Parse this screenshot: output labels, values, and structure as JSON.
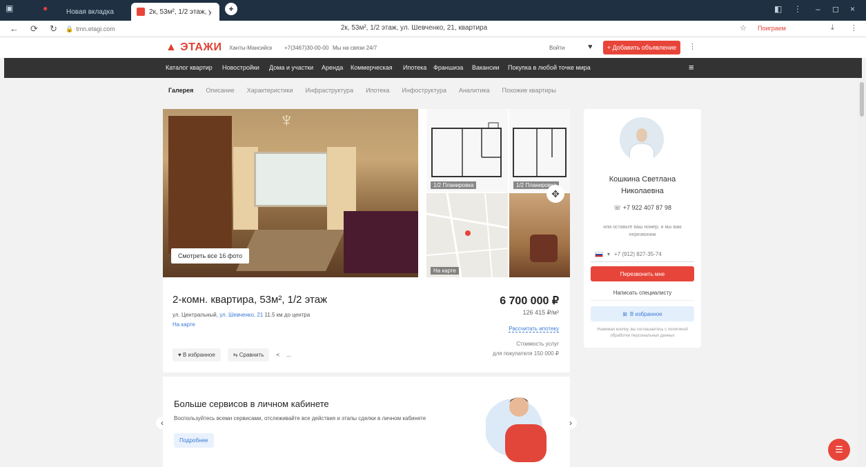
{
  "browser": {
    "tabs": [
      {
        "label": "Новая вкладка",
        "active": false
      },
      {
        "label": "2к, 53м², 1/2 этаж, ул...",
        "active": true
      }
    ],
    "window_title": "2к, 53м², 1/2 этаж, ул. Шевченко, 21, квартира",
    "url": "tmn.etagi.com",
    "profile_label": "Поиграем",
    "new_tab": "+"
  },
  "header": {
    "logo": "ЭТАЖИ",
    "city": "Ханты-Мансийск",
    "phone": "+7(3467)30-00-00",
    "hours": "Мы на связи 24/7",
    "login": "Войти",
    "cta": "+ Добавить объявление"
  },
  "nav": {
    "items": [
      "Каталог квартир",
      "Новостройки",
      "Дома и участки",
      "Аренда",
      "Коммерческая",
      "Ипотека",
      "Франшиза",
      "Вакансии",
      "Покупка в любой точке мира"
    ]
  },
  "subnav": {
    "items": [
      "Галерея",
      "Описание",
      "Характеристики",
      "Инфраструктура",
      "Ипотека",
      "Инфоструктура",
      "Аналитика",
      "Похожие квартиры"
    ],
    "active_index": 0
  },
  "gallery": {
    "photo_label": "Смотреть все 16 фото",
    "plan_caption_1": "1/2 Планировка",
    "plan_caption_2": "1/2 Планировка",
    "map_caption": "На карте"
  },
  "listing": {
    "title": "2-комн. квартира, 53м², 1/2 этаж",
    "address_prefix": "ул. Центральный,",
    "address_link": "ул. Шевченко, 21",
    "address_suffix": "11.5 км до центра",
    "map_link": "На карте",
    "price": "6 700 000 ₽",
    "price_per_m2": "126 415 ₽/м²",
    "mortgage_link": "Рассчитать ипотеку",
    "monthly_1": "Стоимость услуг",
    "monthly_2": "для покупателя 150 000 ₽",
    "actions": {
      "favorite": "В избранное",
      "compare": "Сравнить",
      "share": "<",
      "more": "..."
    }
  },
  "promo": {
    "title": "Больше сервисов в личном кабинете",
    "text": "Воспользуйтесь всеми сервисами, отслеживайте все действия и этапы сделки в личном кабинете",
    "button": "Подробнее"
  },
  "agent": {
    "name_line1": "Кошкина Светлана",
    "name_line2": "Николаевна",
    "phone": "+7 922 407 87 98",
    "note": "или оставьте ваш номер, и мы вам перезвоним",
    "input_placeholder": "+7 (912) 827-35-74",
    "call_button": "Перезвонить мне",
    "specialist_button": "Написать специалисту",
    "favorite_button": "В избранное",
    "small": "Нажимая кнопку, вы соглашаетесь с политикой обработки персональных данных"
  },
  "colors": {
    "accent": "#e8453a",
    "nav_bg": "#333333",
    "link": "#3a7bd5"
  }
}
